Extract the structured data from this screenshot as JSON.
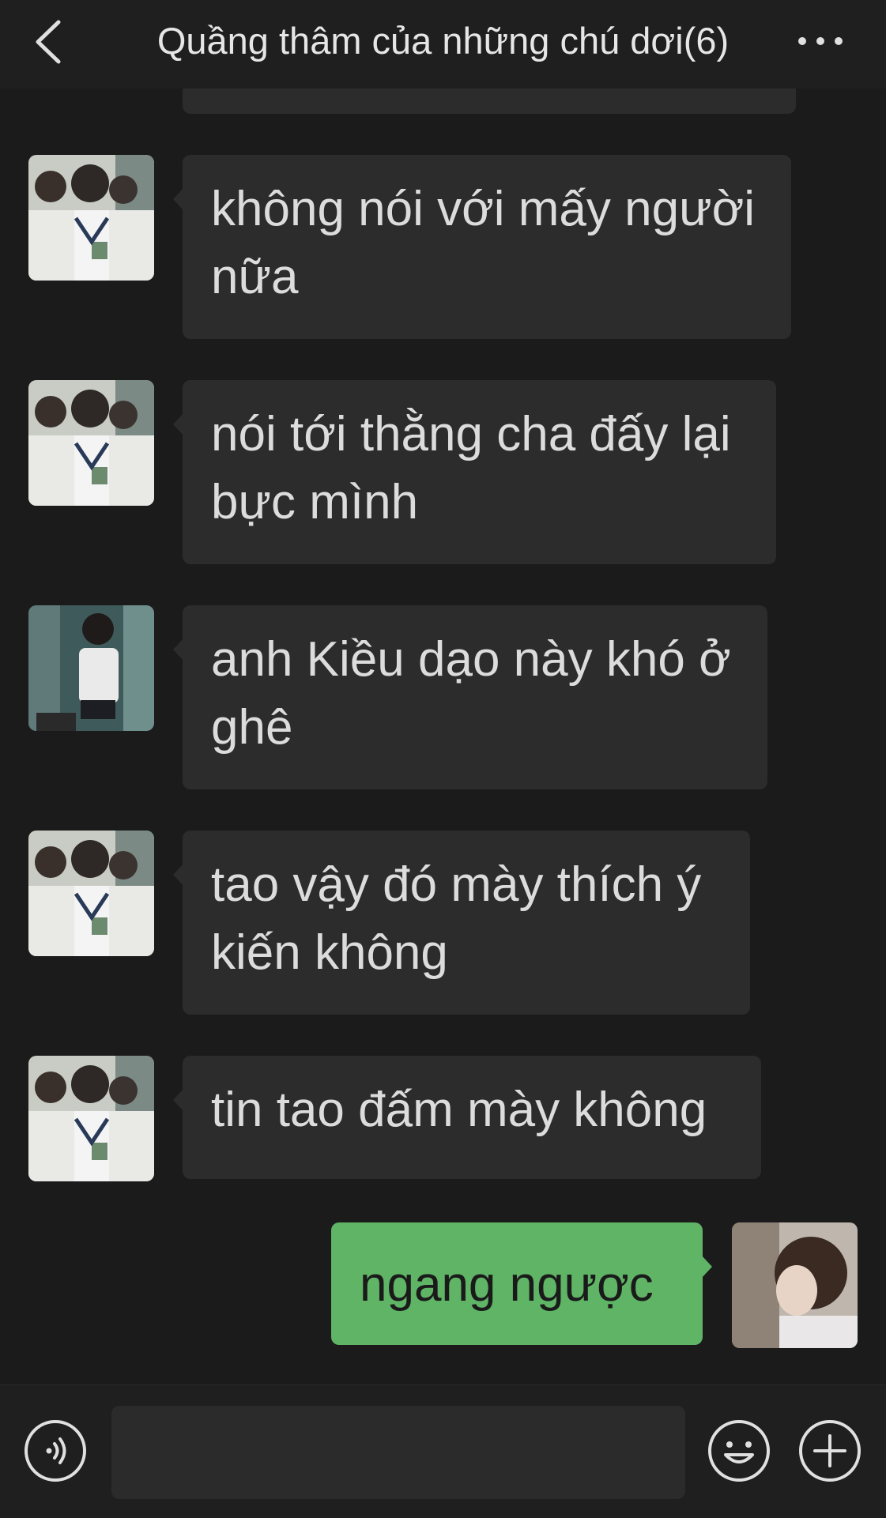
{
  "header": {
    "title": "Quầng thâm của những chú dơi(6)",
    "back_icon": "chevron-left-icon",
    "more_icon": "more-dots-icon"
  },
  "messages": [
    {
      "sender": "other",
      "avatar": "group-photo-avatar",
      "text": "không nói với mấy người nữa"
    },
    {
      "sender": "other",
      "avatar": "group-photo-avatar",
      "text": "nói tới thằng cha đấy lại bực mình"
    },
    {
      "sender": "other",
      "avatar": "single-person-avatar",
      "text": "anh Kiều dạo này khó ở ghê"
    },
    {
      "sender": "other",
      "avatar": "group-photo-avatar",
      "text": "tao vậy đó mày thích ý kiến không"
    },
    {
      "sender": "other",
      "avatar": "group-photo-avatar",
      "text": "tin tao đấm mày không"
    },
    {
      "sender": "self",
      "avatar": "profile-avatar",
      "text": "ngang ngược"
    }
  ],
  "bottom_bar": {
    "input_value": "",
    "voice_icon": "voice-icon",
    "emoji_icon": "emoji-icon",
    "plus_icon": "plus-icon"
  },
  "colors": {
    "background": "#1b1b1b",
    "bubble_other": "#2c2c2c",
    "bubble_self": "#5fb466",
    "text_other": "#dcdcdc",
    "text_self": "#1a1a1a"
  }
}
